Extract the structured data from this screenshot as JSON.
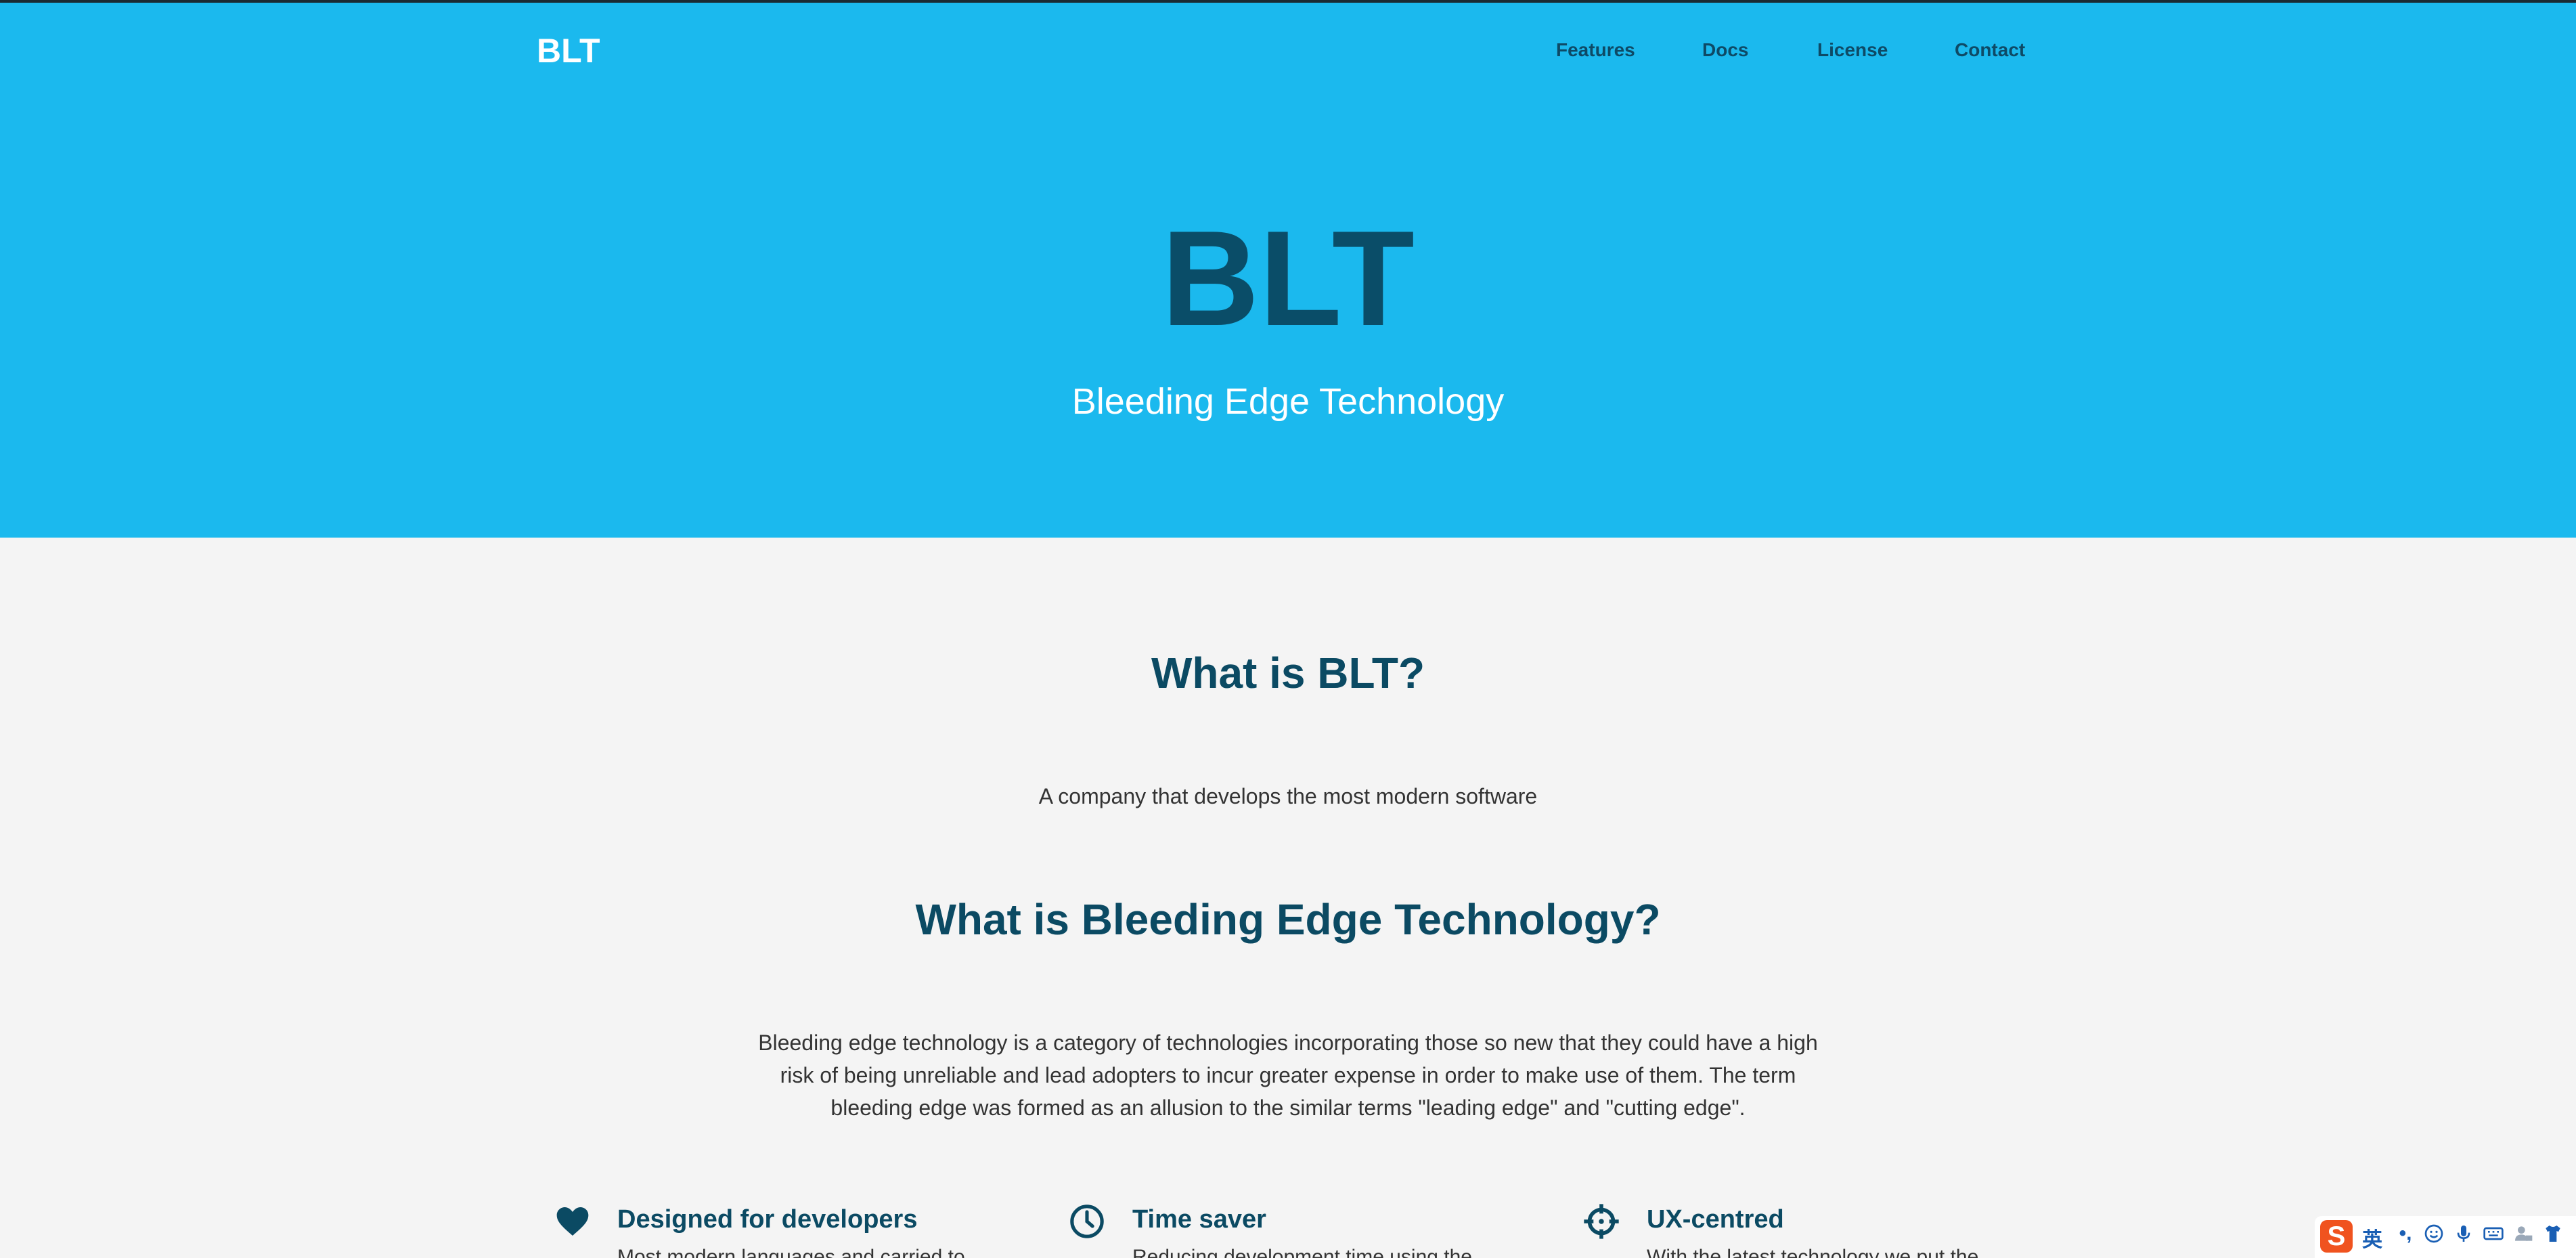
{
  "header": {
    "brand": "BLT",
    "nav": [
      "Features",
      "Docs",
      "License",
      "Contact"
    ]
  },
  "hero": {
    "title": "BLT",
    "subtitle": "Bleeding Edge Technology"
  },
  "about": {
    "heading": "What is BLT?",
    "text": "A company that develops the most modern software"
  },
  "definition": {
    "heading": "What is Bleeding Edge Technology?",
    "lines": [
      "Bleeding edge technology is a category of technologies incorporating those so new that they could have a high",
      "risk of being unreliable and lead adopters to incur greater expense in order to make use of them. The term",
      "bleeding edge was formed as an allusion to the similar terms \"leading edge\" and \"cutting edge\"."
    ]
  },
  "features": [
    {
      "icon": "heart-icon",
      "title": "Designed for developers",
      "desc": "Most modern languages and carried to"
    },
    {
      "icon": "clock-icon",
      "title": "Time saver",
      "desc": "Reducing development time using the"
    },
    {
      "icon": "crosshair-icon",
      "title": "UX-centred",
      "desc": "With the latest technology we put the"
    }
  ],
  "ime": {
    "logo": "S",
    "lang": "英",
    "punct": "•,"
  },
  "colors": {
    "hero": "#1bb9ee",
    "heading": "#0b4a63",
    "background": "#f4f4f4"
  }
}
